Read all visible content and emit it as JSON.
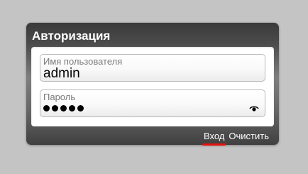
{
  "dialog": {
    "title": "Авторизация"
  },
  "username": {
    "label": "Имя пользователя",
    "value": "admin"
  },
  "password": {
    "label": "Пароль",
    "masked_length": 5,
    "toggle_icon": "eye-icon"
  },
  "actions": {
    "login_label": "Вход",
    "clear_label": "Очистить"
  },
  "colors": {
    "background": "#c4c4c4",
    "accent_underline": "#e3130f",
    "panel_text": "#ffffff"
  }
}
